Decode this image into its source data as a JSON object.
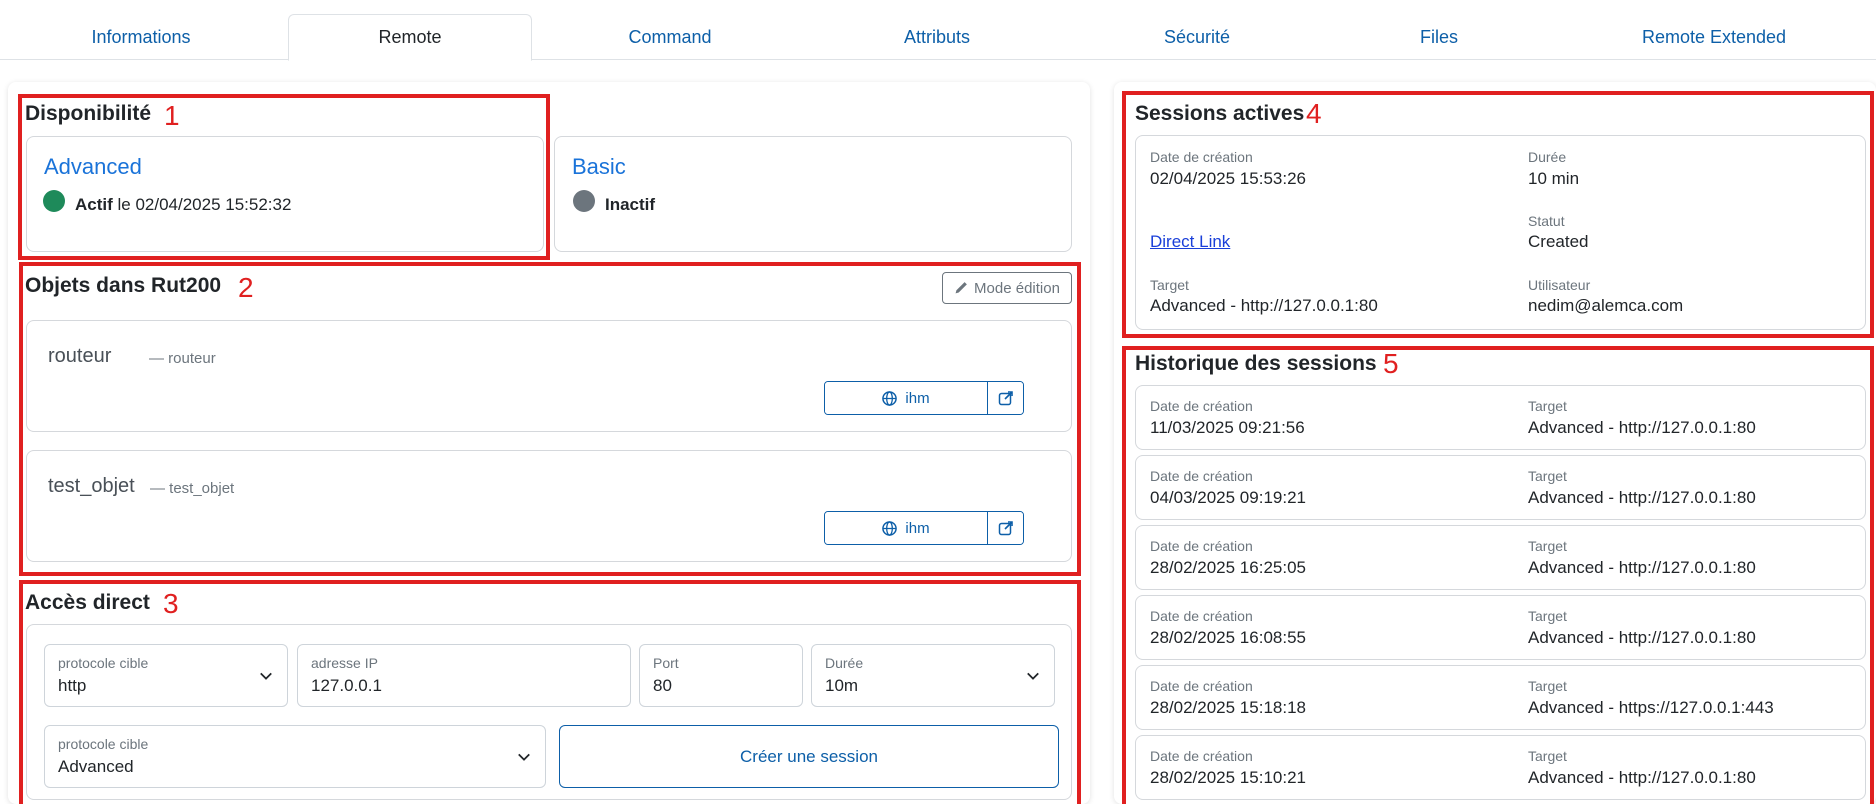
{
  "tabs": [
    {
      "label": "Informations",
      "active": false
    },
    {
      "label": "Remote",
      "active": true
    },
    {
      "label": "Command",
      "active": false
    },
    {
      "label": "Attributs",
      "active": false
    },
    {
      "label": "Sécurité",
      "active": false
    },
    {
      "label": "Files",
      "active": false
    },
    {
      "label": "Remote Extended",
      "active": false
    }
  ],
  "annotations": [
    "1",
    "2",
    "3",
    "4",
    "5"
  ],
  "availability": {
    "title": "Disponibilité",
    "advanced": {
      "title": "Advanced",
      "status": "Actif",
      "suffix": " le 02/04/2025 15:52:32",
      "color": "#1e8a5a"
    },
    "basic": {
      "title": "Basic",
      "status": "Inactif",
      "color": "#6c757d"
    }
  },
  "objects": {
    "title": "Objets dans Rut200",
    "edit_label": "Mode édition",
    "items": [
      {
        "name": "routeur",
        "sub": "— routeur",
        "button": "ihm"
      },
      {
        "name": "test_objet",
        "sub": "— test_objet",
        "button": "ihm"
      }
    ]
  },
  "direct": {
    "title": "Accès direct",
    "protocol": {
      "label": "protocole cible",
      "value": "http"
    },
    "ip": {
      "label": "adresse IP",
      "value": "127.0.0.1"
    },
    "port": {
      "label": "Port",
      "value": "80"
    },
    "duration": {
      "label": "Durée",
      "value": "10m"
    },
    "protocol2": {
      "label": "protocole cible",
      "value": "Advanced"
    },
    "create_label": "Créer une session"
  },
  "active": {
    "title": "Sessions actives",
    "created_label": "Date de création",
    "created": "02/04/2025 15:53:26",
    "duration_label": "Durée",
    "duration": "10 min",
    "link": "Direct Link",
    "status_label": "Statut",
    "status": "Created",
    "target_label": "Target",
    "target": "Advanced - http://127.0.0.1:80",
    "user_label": "Utilisateur",
    "user": "nedim@alemca.com"
  },
  "history": {
    "title": "Historique des sessions",
    "created_label": "Date de création",
    "target_label": "Target",
    "items": [
      {
        "date": "11/03/2025 09:21:56",
        "target": "Advanced - http://127.0.0.1:80"
      },
      {
        "date": "04/03/2025 09:19:21",
        "target": "Advanced - http://127.0.0.1:80"
      },
      {
        "date": "28/02/2025 16:25:05",
        "target": "Advanced - http://127.0.0.1:80"
      },
      {
        "date": "28/02/2025 16:08:55",
        "target": "Advanced - http://127.0.0.1:80"
      },
      {
        "date": "28/02/2025 15:18:18",
        "target": "Advanced - https://127.0.0.1:443"
      },
      {
        "date": "28/02/2025 15:10:21",
        "target": "Advanced - http://127.0.0.1:80"
      }
    ]
  }
}
